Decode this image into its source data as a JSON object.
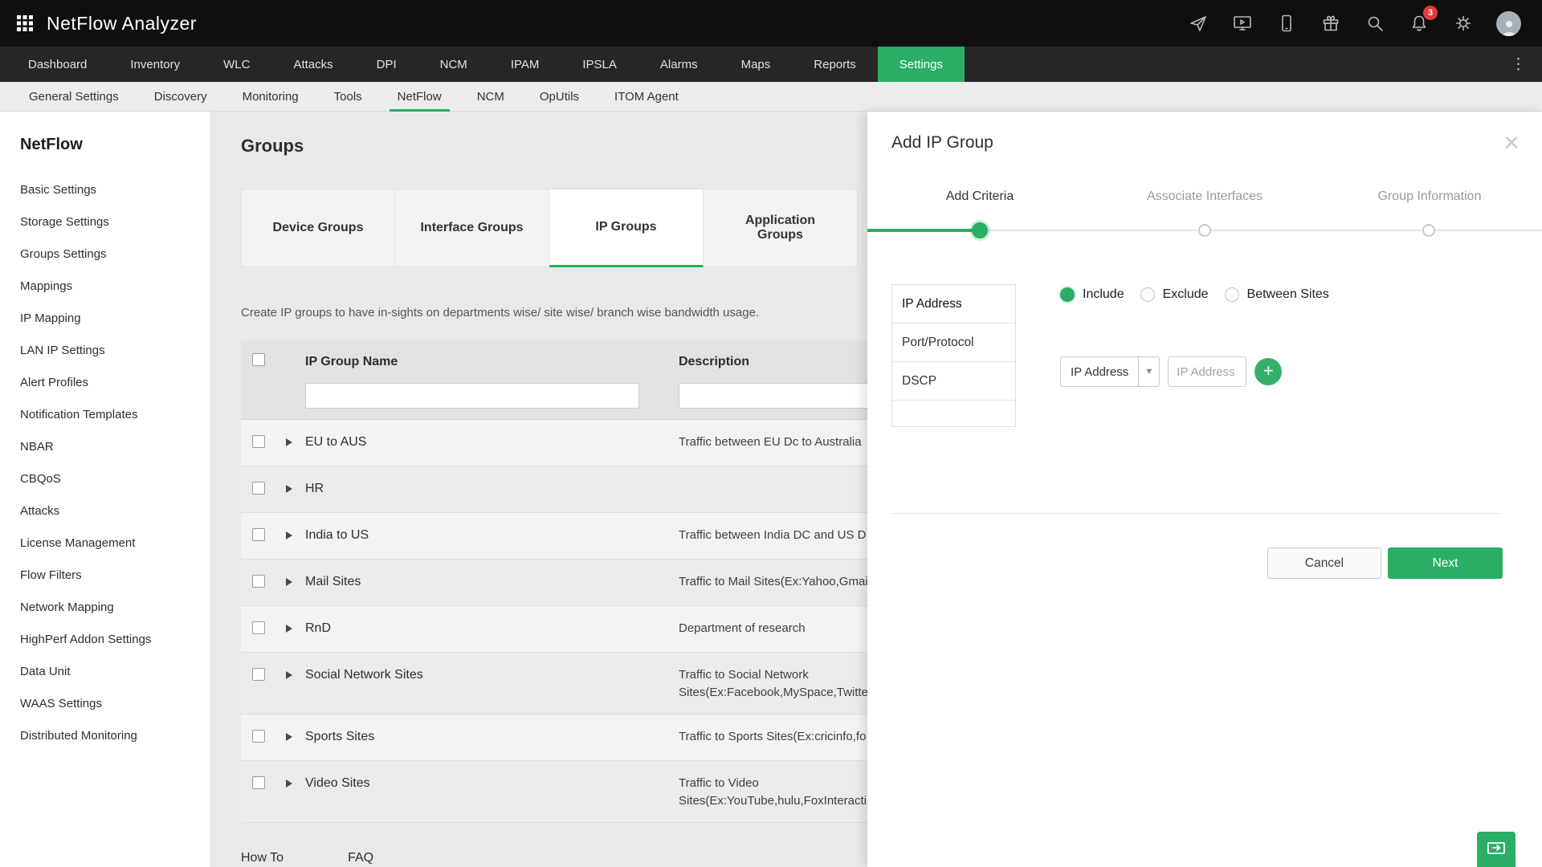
{
  "app": {
    "title": "NetFlow Analyzer"
  },
  "colors": {
    "accent_green": "#2aad64",
    "badge_red": "#e6393c",
    "topbar_black": "#0f0f0f"
  },
  "topbar": {
    "notification_count": "3",
    "icons": [
      "apps-grid",
      "launch",
      "demo-screen",
      "mobile",
      "gift",
      "search",
      "notifications-bell",
      "settings-gear",
      "user-avatar"
    ]
  },
  "mainnav": {
    "items": [
      "Dashboard",
      "Inventory",
      "WLC",
      "Attacks",
      "DPI",
      "NCM",
      "IPAM",
      "IPSLA",
      "Alarms",
      "Maps",
      "Reports",
      "Settings"
    ],
    "active": "Settings",
    "overflow_icon": "kebab-menu"
  },
  "subnav": {
    "items": [
      "General Settings",
      "Discovery",
      "Monitoring",
      "Tools",
      "NetFlow",
      "NCM",
      "OpUtils",
      "ITOM Agent"
    ],
    "active": "NetFlow"
  },
  "sidebar": {
    "heading": "NetFlow",
    "items": [
      "Basic Settings",
      "Storage Settings",
      "Groups Settings",
      "Mappings",
      "IP Mapping",
      "LAN IP Settings",
      "Alert Profiles",
      "Notification Templates",
      "NBAR",
      "CBQoS",
      "Attacks",
      "License Management",
      "Flow Filters",
      "Network Mapping",
      "HighPerf Addon Settings",
      "Data Unit",
      "WAAS Settings",
      "Distributed Monitoring"
    ]
  },
  "main": {
    "title": "Groups",
    "tabs": [
      "Device Groups",
      "Interface Groups",
      "IP Groups",
      "Application Groups"
    ],
    "active_tab": "IP Groups",
    "description": "Create IP groups to have in-sights on departments wise/ site wise/ branch wise bandwidth usage.",
    "table": {
      "columns": [
        "IP Group Name",
        "Description"
      ],
      "filter_placeholders": [
        "",
        ""
      ],
      "rows": [
        {
          "name": "EU to AUS",
          "description": "Traffic between EU Dc to Australia"
        },
        {
          "name": "HR",
          "description": ""
        },
        {
          "name": "India to US",
          "description": "Traffic between India DC and US D"
        },
        {
          "name": "Mail Sites",
          "description": "Traffic to Mail Sites(Ex:Yahoo,Gmai"
        },
        {
          "name": "RnD",
          "description": "Department of research"
        },
        {
          "name": "Social Network Sites",
          "description": "Traffic to Social Network\nSites(Ex:Facebook,MySpace,Twitte"
        },
        {
          "name": "Sports Sites",
          "description": "Traffic to Sports Sites(Ex:cricinfo,fo"
        },
        {
          "name": "Video Sites",
          "description": "Traffic to Video\nSites(Ex:YouTube,hulu,FoxInteracti"
        }
      ]
    },
    "footer_links": [
      "How To",
      "FAQ"
    ]
  },
  "modal": {
    "title": "Add IP Group",
    "steps": [
      "Add Criteria",
      "Associate Interfaces",
      "Group Information"
    ],
    "active_step": "Add Criteria",
    "criteria_tabs": [
      "IP Address",
      "Port/Protocol",
      "DSCP"
    ],
    "active_criteria_tab": "IP Address",
    "radio_options": [
      "Include",
      "Exclude",
      "Between Sites"
    ],
    "selected_radio": "Include",
    "ip_type_select": "IP Address",
    "ip_input_placeholder": "IP Address",
    "cancel_label": "Cancel",
    "next_label": "Next"
  }
}
